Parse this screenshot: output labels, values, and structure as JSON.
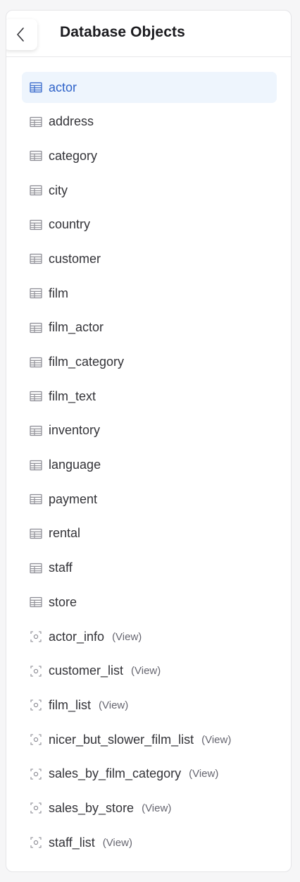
{
  "header": {
    "title": "Database Objects",
    "back_icon": "chevron-left-icon"
  },
  "colors": {
    "selected_bg": "#eef5fd",
    "selected_text": "#2f63c9",
    "text": "#333338",
    "icon": "#8a8a92"
  },
  "objects": [
    {
      "name": "actor",
      "kind": "table",
      "selected": true
    },
    {
      "name": "address",
      "kind": "table"
    },
    {
      "name": "category",
      "kind": "table"
    },
    {
      "name": "city",
      "kind": "table"
    },
    {
      "name": "country",
      "kind": "table"
    },
    {
      "name": "customer",
      "kind": "table"
    },
    {
      "name": "film",
      "kind": "table"
    },
    {
      "name": "film_actor",
      "kind": "table"
    },
    {
      "name": "film_category",
      "kind": "table"
    },
    {
      "name": "film_text",
      "kind": "table"
    },
    {
      "name": "inventory",
      "kind": "table"
    },
    {
      "name": "language",
      "kind": "table"
    },
    {
      "name": "payment",
      "kind": "table"
    },
    {
      "name": "rental",
      "kind": "table"
    },
    {
      "name": "staff",
      "kind": "table"
    },
    {
      "name": "store",
      "kind": "table"
    },
    {
      "name": "actor_info",
      "kind": "view",
      "suffix": "(View)"
    },
    {
      "name": "customer_list",
      "kind": "view",
      "suffix": "(View)"
    },
    {
      "name": "film_list",
      "kind": "view",
      "suffix": "(View)"
    },
    {
      "name": "nicer_but_slower_film_list",
      "kind": "view",
      "suffix": "(View)"
    },
    {
      "name": "sales_by_film_category",
      "kind": "view",
      "suffix": "(View)"
    },
    {
      "name": "sales_by_store",
      "kind": "view",
      "suffix": "(View)"
    },
    {
      "name": "staff_list",
      "kind": "view",
      "suffix": "(View)"
    }
  ]
}
